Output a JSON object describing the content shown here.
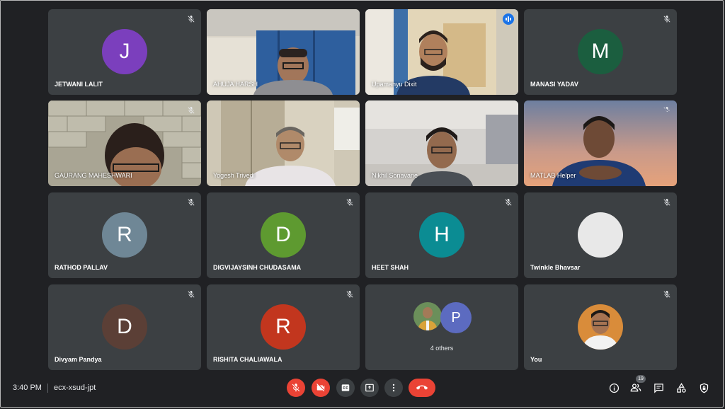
{
  "colors": {
    "background": "#202124",
    "tile": "#3c4043",
    "speaking_outline": "#8ab4f8",
    "end_call": "#ea4335"
  },
  "tiles": [
    {
      "name": "JETWANI LALIT",
      "initial": "J",
      "avatar_color": "#7b3fbd",
      "muted": true
    },
    {
      "name": "AHUJA HARSH",
      "muted": false,
      "video": true
    },
    {
      "name": "Upamanyu Dixit",
      "muted": false,
      "video": true,
      "speaking": true
    },
    {
      "name": "MANASI YADAV",
      "initial": "M",
      "avatar_color": "#1b5e3f",
      "muted": true
    },
    {
      "name": "GAURANG MAHESHWARI",
      "muted": true,
      "video": true
    },
    {
      "name": "Yogesh Trivedi",
      "muted": false,
      "video": true
    },
    {
      "name": "Nikhil Sonavane",
      "muted": false,
      "video": true
    },
    {
      "name": "MATLAB Helper",
      "muted": true,
      "video": true
    },
    {
      "name": "RATHOD PALLAV",
      "initial": "R",
      "avatar_color": "#6f8796",
      "muted": true
    },
    {
      "name": "DIGVIJAYSINH CHUDASAMA",
      "initial": "D",
      "avatar_color": "#5e9a30",
      "muted": true
    },
    {
      "name": "HEET SHAH",
      "initial": "H",
      "avatar_color": "#0b8c93",
      "muted": true
    },
    {
      "name": "Twinkle Bhavsar",
      "initial": "",
      "avatar_color": "#e8e8e8",
      "muted": true
    },
    {
      "name": "Divyam Pandya",
      "initial": "D",
      "avatar_color": "#5b3f36",
      "muted": true
    },
    {
      "name": "RISHITA CHALIAWALA",
      "initial": "R",
      "avatar_color": "#c2361e",
      "muted": true
    },
    {
      "name": "",
      "others_label": "4 others",
      "others_initial": "P",
      "others_color": "#5c6bc0",
      "muted": false
    },
    {
      "name": "You",
      "muted": true,
      "self": true
    }
  ],
  "bottom_bar": {
    "time": "3:40 PM",
    "meeting_code": "ecx-xsud-jpt",
    "participant_count": "19",
    "controls": {
      "mic": "mic-off-icon",
      "camera": "camera-off-icon",
      "captions": "closed-captions-icon",
      "present": "present-screen-icon",
      "more": "more-options-icon",
      "end": "end-call-icon"
    },
    "right_icons": [
      "info-icon",
      "people-icon",
      "chat-icon",
      "activities-icon",
      "host-controls-icon"
    ]
  }
}
